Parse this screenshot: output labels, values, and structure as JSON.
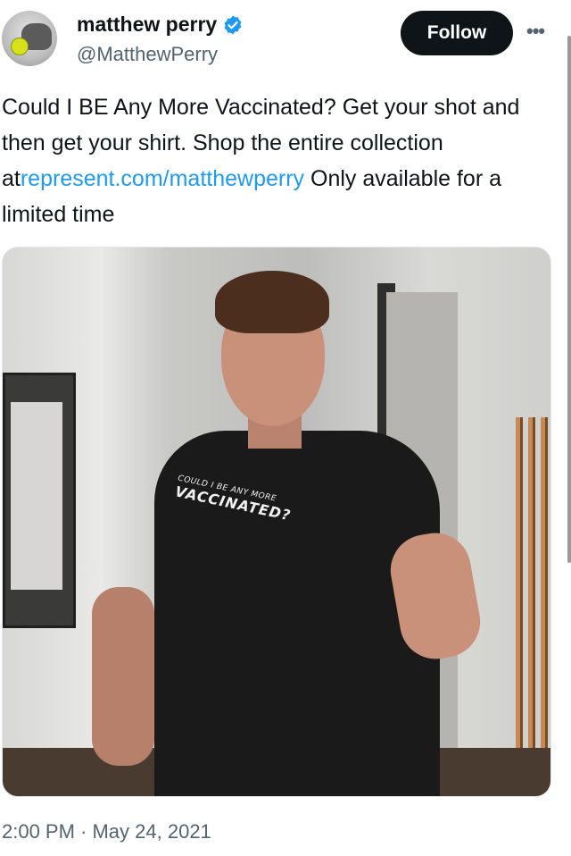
{
  "author": {
    "name": "matthew perry",
    "handle": "@MatthewPerry",
    "verified_color": "#1d9bf0"
  },
  "actions": {
    "follow_label": "Follow",
    "more_label": "•••"
  },
  "tweet": {
    "text_before": "Could I BE Any More Vaccinated? Get your shot and then get your shirt. Shop the entire collection at",
    "link_text": "represent.com/matthewperry",
    "text_after": " Only available for a limited time",
    "timestamp": "2:00 PM · May 24, 2021"
  },
  "media": {
    "shirt_line1": "COULD I BE ANY MORE",
    "shirt_line2": "VACCINATED?"
  },
  "colors": {
    "text": "#0f1419",
    "secondary": "#536471",
    "link": "#1d9bf0",
    "button_bg": "#0f1419"
  }
}
